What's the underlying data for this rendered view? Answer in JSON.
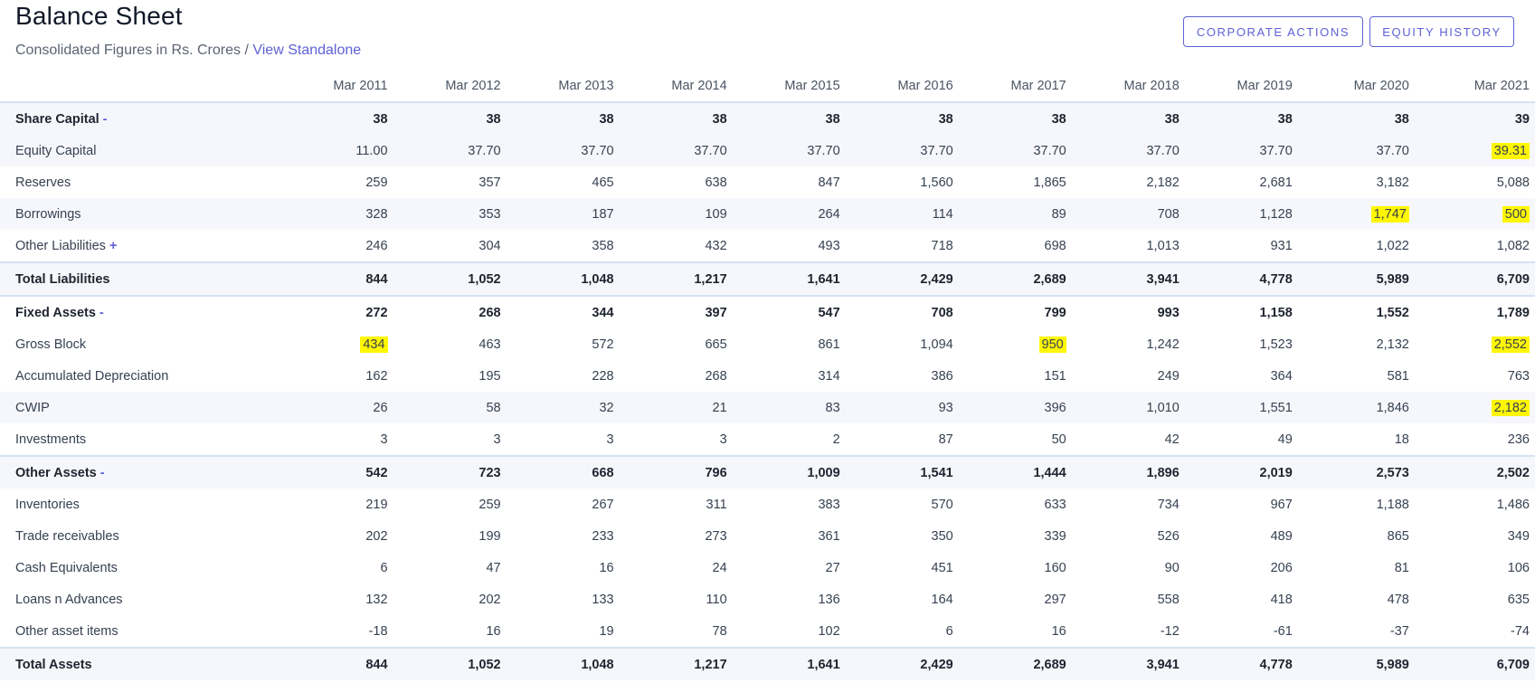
{
  "header": {
    "title": "Balance Sheet",
    "subtitle": "Consolidated Figures in Rs. Crores",
    "separator": "/",
    "standalone_link": "View Standalone",
    "buttons": {
      "corporate_actions": "CORPORATE ACTIONS",
      "equity_history": "EQUITY HISTORY"
    }
  },
  "columns": [
    "Mar 2011",
    "Mar 2012",
    "Mar 2013",
    "Mar 2014",
    "Mar 2015",
    "Mar 2016",
    "Mar 2017",
    "Mar 2018",
    "Mar 2019",
    "Mar 2020",
    "Mar 2021"
  ],
  "rows": [
    {
      "label": "Share Capital",
      "toggle": "-",
      "bold": true,
      "stripe": true,
      "topline": false,
      "values": [
        "38",
        "38",
        "38",
        "38",
        "38",
        "38",
        "38",
        "38",
        "38",
        "38",
        "39"
      ],
      "highlight": []
    },
    {
      "label": "Equity Capital",
      "toggle": "",
      "bold": false,
      "stripe": true,
      "topline": false,
      "values": [
        "11.00",
        "37.70",
        "37.70",
        "37.70",
        "37.70",
        "37.70",
        "37.70",
        "37.70",
        "37.70",
        "37.70",
        "39.31"
      ],
      "highlight": [
        10
      ]
    },
    {
      "label": "Reserves",
      "toggle": "",
      "bold": false,
      "stripe": false,
      "topline": false,
      "values": [
        "259",
        "357",
        "465",
        "638",
        "847",
        "1,560",
        "1,865",
        "2,182",
        "2,681",
        "3,182",
        "5,088"
      ],
      "highlight": []
    },
    {
      "label": "Borrowings",
      "toggle": "",
      "bold": false,
      "stripe": true,
      "topline": false,
      "values": [
        "328",
        "353",
        "187",
        "109",
        "264",
        "114",
        "89",
        "708",
        "1,128",
        "1,747",
        "500"
      ],
      "highlight": [
        9,
        10
      ]
    },
    {
      "label": "Other Liabilities",
      "toggle": "+",
      "bold": false,
      "stripe": false,
      "topline": false,
      "values": [
        "246",
        "304",
        "358",
        "432",
        "493",
        "718",
        "698",
        "1,013",
        "931",
        "1,022",
        "1,082"
      ],
      "highlight": []
    },
    {
      "label": "Total Liabilities",
      "toggle": "",
      "bold": true,
      "stripe": true,
      "topline": true,
      "values": [
        "844",
        "1,052",
        "1,048",
        "1,217",
        "1,641",
        "2,429",
        "2,689",
        "3,941",
        "4,778",
        "5,989",
        "6,709"
      ],
      "highlight": []
    },
    {
      "label": "Fixed Assets",
      "toggle": "-",
      "bold": true,
      "stripe": false,
      "topline": true,
      "values": [
        "272",
        "268",
        "344",
        "397",
        "547",
        "708",
        "799",
        "993",
        "1,158",
        "1,552",
        "1,789"
      ],
      "highlight": []
    },
    {
      "label": "Gross Block",
      "toggle": "",
      "bold": false,
      "stripe": false,
      "topline": false,
      "values": [
        "434",
        "463",
        "572",
        "665",
        "861",
        "1,094",
        "950",
        "1,242",
        "1,523",
        "2,132",
        "2,552"
      ],
      "highlight": [
        0,
        6,
        10
      ]
    },
    {
      "label": "Accumulated Depreciation",
      "toggle": "",
      "bold": false,
      "stripe": false,
      "topline": false,
      "values": [
        "162",
        "195",
        "228",
        "268",
        "314",
        "386",
        "151",
        "249",
        "364",
        "581",
        "763"
      ],
      "highlight": []
    },
    {
      "label": "CWIP",
      "toggle": "",
      "bold": false,
      "stripe": true,
      "topline": false,
      "values": [
        "26",
        "58",
        "32",
        "21",
        "83",
        "93",
        "396",
        "1,010",
        "1,551",
        "1,846",
        "2,182"
      ],
      "highlight": [
        10
      ]
    },
    {
      "label": "Investments",
      "toggle": "",
      "bold": false,
      "stripe": false,
      "topline": false,
      "values": [
        "3",
        "3",
        "3",
        "3",
        "2",
        "87",
        "50",
        "42",
        "49",
        "18",
        "236"
      ],
      "highlight": []
    },
    {
      "label": "Other Assets",
      "toggle": "-",
      "bold": true,
      "stripe": true,
      "topline": true,
      "values": [
        "542",
        "723",
        "668",
        "796",
        "1,009",
        "1,541",
        "1,444",
        "1,896",
        "2,019",
        "2,573",
        "2,502"
      ],
      "highlight": []
    },
    {
      "label": "Inventories",
      "toggle": "",
      "bold": false,
      "stripe": false,
      "topline": false,
      "values": [
        "219",
        "259",
        "267",
        "311",
        "383",
        "570",
        "633",
        "734",
        "967",
        "1,188",
        "1,486"
      ],
      "highlight": []
    },
    {
      "label": "Trade receivables",
      "toggle": "",
      "bold": false,
      "stripe": false,
      "topline": false,
      "values": [
        "202",
        "199",
        "233",
        "273",
        "361",
        "350",
        "339",
        "526",
        "489",
        "865",
        "349"
      ],
      "highlight": []
    },
    {
      "label": "Cash Equivalents",
      "toggle": "",
      "bold": false,
      "stripe": false,
      "topline": false,
      "values": [
        "6",
        "47",
        "16",
        "24",
        "27",
        "451",
        "160",
        "90",
        "206",
        "81",
        "106"
      ],
      "highlight": []
    },
    {
      "label": "Loans n Advances",
      "toggle": "",
      "bold": false,
      "stripe": false,
      "topline": false,
      "values": [
        "132",
        "202",
        "133",
        "110",
        "136",
        "164",
        "297",
        "558",
        "418",
        "478",
        "635"
      ],
      "highlight": []
    },
    {
      "label": "Other asset items",
      "toggle": "",
      "bold": false,
      "stripe": false,
      "topline": false,
      "values": [
        "-18",
        "16",
        "19",
        "78",
        "102",
        "6",
        "16",
        "-12",
        "-61",
        "-37",
        "-74"
      ],
      "highlight": []
    },
    {
      "label": "Total Assets",
      "toggle": "",
      "bold": true,
      "stripe": true,
      "topline": true,
      "values": [
        "844",
        "1,052",
        "1,048",
        "1,217",
        "1,641",
        "2,429",
        "2,689",
        "3,941",
        "4,778",
        "5,989",
        "6,709"
      ],
      "highlight": []
    }
  ],
  "colors": {
    "accent": "#5f61d6",
    "highlight": "#fff700",
    "stripe": "#f6f7fc",
    "rule": "#d6e2f3"
  }
}
